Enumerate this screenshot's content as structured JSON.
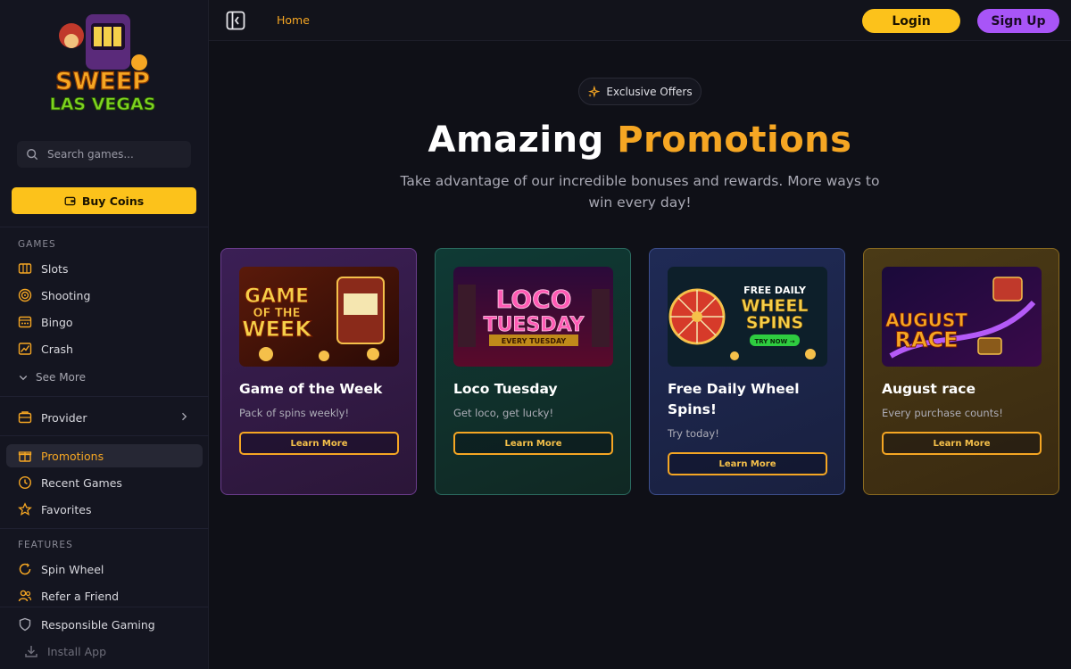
{
  "brand": {
    "logo_line1": "SWEEP",
    "logo_line2": "LAS VEGAS"
  },
  "search": {
    "placeholder": "Search games..."
  },
  "sidebar": {
    "buy_coins": "Buy Coins",
    "games_title": "GAMES",
    "games": [
      {
        "label": "Slots",
        "icon": "slot-machine-icon"
      },
      {
        "label": "Shooting",
        "icon": "target-icon"
      },
      {
        "label": "Bingo",
        "icon": "bingo-card-icon"
      },
      {
        "label": "Crash",
        "icon": "crash-chart-icon"
      }
    ],
    "see_more": "See More",
    "provider": "Provider",
    "links": [
      {
        "label": "Promotions",
        "icon": "gift-icon",
        "active": true
      },
      {
        "label": "Recent Games",
        "icon": "clock-icon"
      },
      {
        "label": "Favorites",
        "icon": "star-icon"
      }
    ],
    "features_title": "FEATURES",
    "features": [
      {
        "label": "Spin Wheel",
        "icon": "spin-wheel-icon"
      },
      {
        "label": "Refer a Friend",
        "icon": "users-icon"
      }
    ],
    "responsible_gaming": "Responsible Gaming",
    "install_app": "Install App"
  },
  "header": {
    "home": "Home",
    "login": "Login",
    "signup": "Sign Up"
  },
  "hero": {
    "badge": "Exclusive Offers",
    "title_white": "Amazing",
    "title_accent": "Promotions",
    "subtitle": "Take advantage of our incredible bonuses and rewards. More ways to win every day!"
  },
  "promotions": [
    {
      "title": "Game of the Week",
      "description": "Pack of spins weekly!",
      "button": "Learn More",
      "image_text": [
        "GAME",
        "OF THE",
        "WEEK"
      ]
    },
    {
      "title": "Loco Tuesday",
      "description": "Get loco, get lucky!",
      "button": "Learn More",
      "image_text": [
        "LOCO",
        "TUESDAY",
        "EVERY TUESDAY"
      ]
    },
    {
      "title": "Free Daily Wheel Spins!",
      "description": "Try today!",
      "button": "Learn More",
      "image_text": [
        "FREE DAILY",
        "WHEEL",
        "SPINS",
        "TRY NOW →"
      ]
    },
    {
      "title": "August race",
      "description": "Every purchase counts!",
      "button": "Learn More",
      "image_text": [
        "AUGUST",
        "RACE"
      ]
    }
  ],
  "colors": {
    "accent": "#f5a623",
    "yellow": "#fcc21b",
    "purple": "#a855f7",
    "bg": "#0f1017"
  }
}
